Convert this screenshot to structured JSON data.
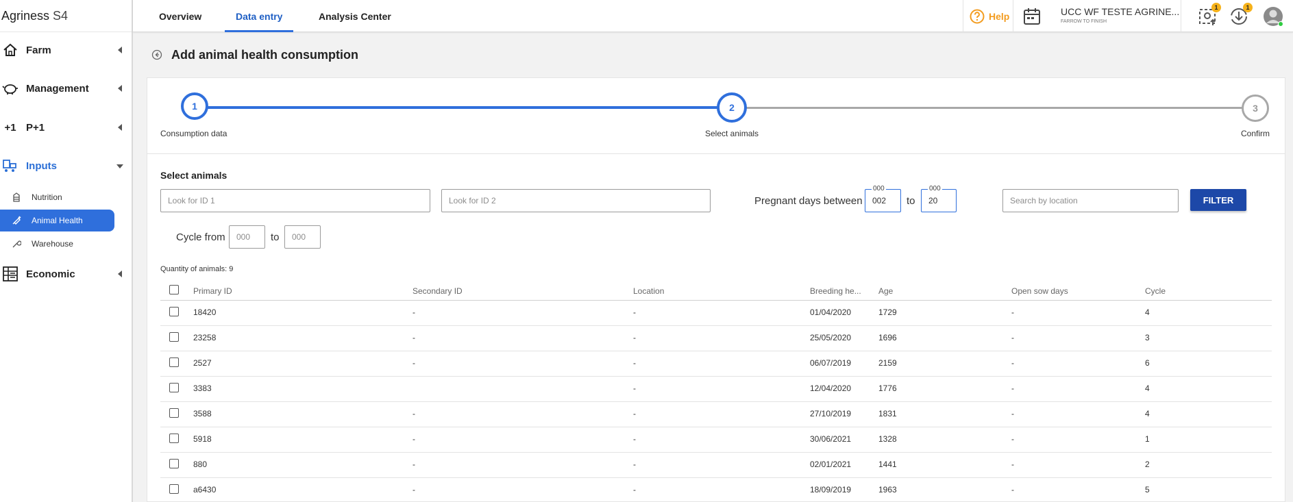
{
  "brand": {
    "name": "Agriness",
    "suffix": "S4"
  },
  "sidebar": {
    "items": [
      {
        "label": "Farm",
        "icon": "house-icon"
      },
      {
        "label": "Management",
        "icon": "piggy-icon"
      },
      {
        "label": "P+1",
        "icon": "plus-one-icon"
      },
      {
        "label": "Inputs",
        "icon": "inputs-icon",
        "open": true
      },
      {
        "label": "Economic",
        "icon": "spreadsheet-icon"
      }
    ],
    "sub_items": [
      {
        "label": "Nutrition",
        "icon": "silo-icon"
      },
      {
        "label": "Animal Health",
        "icon": "syringe-icon",
        "active": true
      },
      {
        "label": "Warehouse",
        "icon": "wrench-icon"
      }
    ]
  },
  "topbar": {
    "tabs": [
      {
        "label": "Overview"
      },
      {
        "label": "Data entry",
        "active": true
      },
      {
        "label": "Analysis Center"
      }
    ],
    "help_label": "Help",
    "farm_name": "UCC WF TESTE AGRINE...",
    "farm_type": "FARROW TO FINISH",
    "badge_1": "1",
    "badge_2": "1"
  },
  "page": {
    "title": "Add animal health consumption"
  },
  "stepper": {
    "steps": [
      {
        "number": "1",
        "label": "Consumption data"
      },
      {
        "number": "2",
        "label": "Select animals"
      },
      {
        "number": "3",
        "label": "Confirm"
      }
    ]
  },
  "filters": {
    "section_title": "Select animals",
    "id1_placeholder": "Look for ID 1",
    "id2_placeholder": "Look for ID 2",
    "pregnant_label": "Pregnant days between",
    "pregnant_from_hint": "000",
    "pregnant_from_value": "002",
    "to_label": "to",
    "pregnant_to_hint": "000",
    "pregnant_to_value": "20",
    "location_placeholder": "Search by location",
    "filter_button": "FILTER",
    "cycle_label": "Cycle from",
    "cycle_from_placeholder": "000",
    "cycle_to_placeholder": "000"
  },
  "table": {
    "quantity_text": "Quantity of animals: 9",
    "columns": [
      "Primary ID",
      "Secondary ID",
      "Location",
      "Breeding he...",
      "Age",
      "Open sow days",
      "Cycle"
    ],
    "rows": [
      {
        "primary_id": "18420",
        "secondary_id": "-",
        "location": "-",
        "breeding": "01/04/2020",
        "age": "1729",
        "open_sow_days": "-",
        "cycle": "4"
      },
      {
        "primary_id": "23258",
        "secondary_id": "-",
        "location": "-",
        "breeding": "25/05/2020",
        "age": "1696",
        "open_sow_days": "-",
        "cycle": "3"
      },
      {
        "primary_id": "2527",
        "secondary_id": "-",
        "location": "-",
        "breeding": "06/07/2019",
        "age": "2159",
        "open_sow_days": "-",
        "cycle": "6"
      },
      {
        "primary_id": "3383",
        "secondary_id": "",
        "location": "-",
        "breeding": "12/04/2020",
        "age": "1776",
        "open_sow_days": "-",
        "cycle": "4"
      },
      {
        "primary_id": "3588",
        "secondary_id": "-",
        "location": "-",
        "breeding": "27/10/2019",
        "age": "1831",
        "open_sow_days": "-",
        "cycle": "4"
      },
      {
        "primary_id": "5918",
        "secondary_id": "-",
        "location": "-",
        "breeding": "30/06/2021",
        "age": "1328",
        "open_sow_days": "-",
        "cycle": "1"
      },
      {
        "primary_id": "880",
        "secondary_id": "-",
        "location": "-",
        "breeding": "02/01/2021",
        "age": "1441",
        "open_sow_days": "-",
        "cycle": "2"
      },
      {
        "primary_id": "a6430",
        "secondary_id": "-",
        "location": "-",
        "breeding": "18/09/2019",
        "age": "1963",
        "open_sow_days": "-",
        "cycle": "5"
      }
    ]
  },
  "colors": {
    "accent": "#2f6fdc",
    "filter_button": "#1d48a8",
    "help": "#f39c1f",
    "badge": "#f6b21a"
  }
}
